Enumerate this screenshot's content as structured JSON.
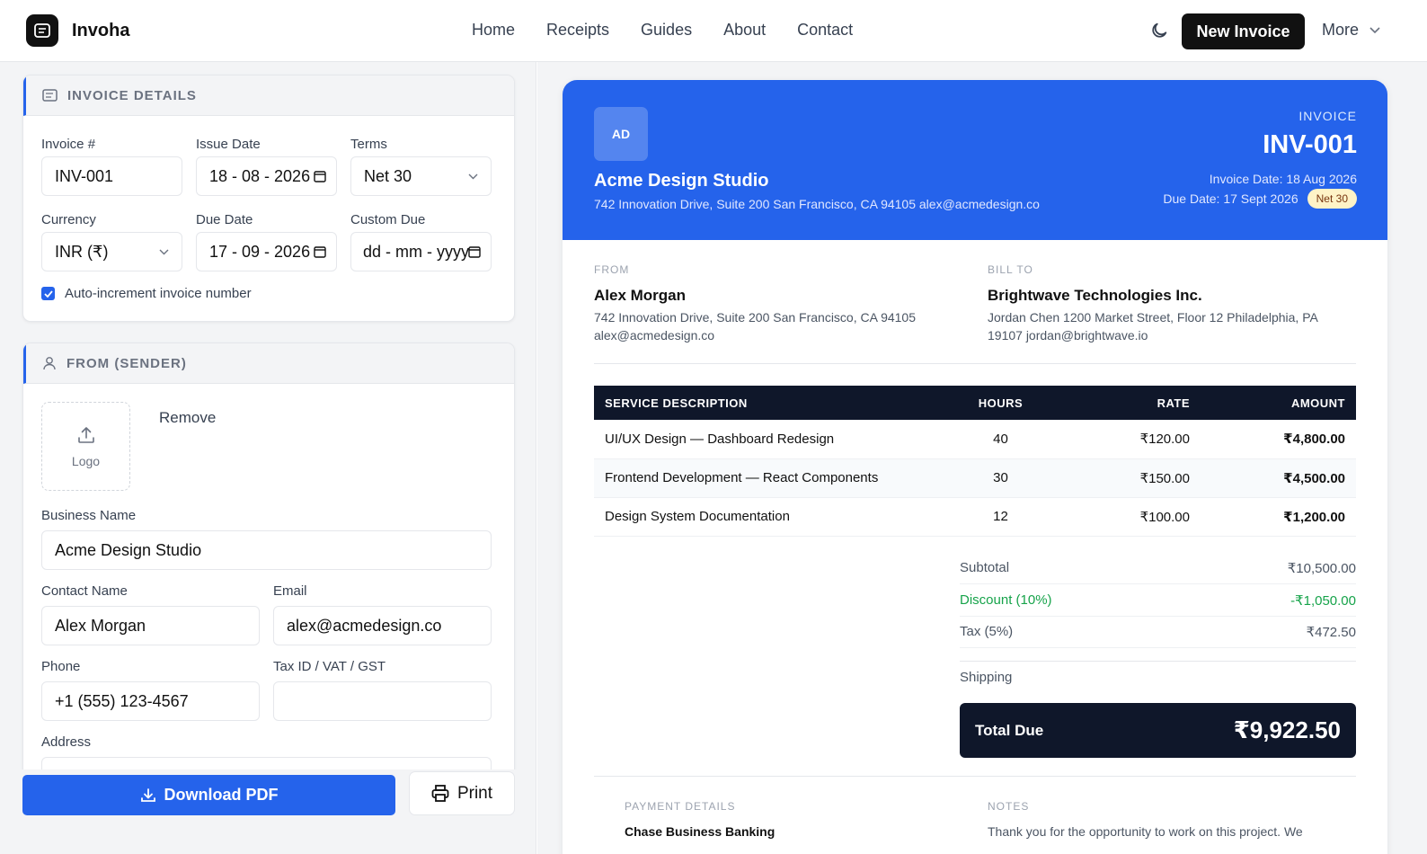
{
  "header": {
    "brand": "Invoha",
    "nav": [
      "Home",
      "Receipts",
      "Guides",
      "About",
      "Contact"
    ],
    "new_invoice": "New Invoice",
    "more": "More"
  },
  "invoice_details": {
    "title": "INVOICE DETAILS",
    "invoice_no_label": "Invoice #",
    "invoice_no": "INV-001",
    "issue_date_label": "Issue Date",
    "issue_date": "18 - 08 - 2026",
    "terms_label": "Terms",
    "terms": "Net 30",
    "currency_label": "Currency",
    "currency": "INR (₹)",
    "due_date_label": "Due Date",
    "due_date": "17 - 09 - 2026",
    "custom_due_label": "Custom Due",
    "custom_due_placeholder": "dd - mm - yyyy",
    "auto_increment_label": "Auto-increment invoice number",
    "auto_increment_checked": true
  },
  "sender": {
    "title": "FROM (SENDER)",
    "logo_label": "Logo",
    "remove": "Remove",
    "business_name_label": "Business Name",
    "business_name": "Acme Design Studio",
    "contact_name_label": "Contact Name",
    "contact_name": "Alex Morgan",
    "email_label": "Email",
    "email": "alex@acmedesign.co",
    "phone_label": "Phone",
    "phone": "+1 (555) 123-4567",
    "tax_id_label": "Tax ID / VAT / GST",
    "tax_id": "",
    "address_label": "Address"
  },
  "actions": {
    "download": "Download PDF",
    "print": "Print"
  },
  "preview": {
    "avatar": "AD",
    "company": "Acme Design Studio",
    "company_address": "742 Innovation Drive, Suite 200 San Francisco, CA 94105 alex@acmedesign.co",
    "invoice_label": "INVOICE",
    "invoice_number": "INV-001",
    "invoice_date": "Invoice Date: 18 Aug 2026",
    "due_date": "Due Date: 17 Sept 2026",
    "terms_badge": "Net 30",
    "from_label": "FROM",
    "from_name": "Alex Morgan",
    "from_address_1": "742 Innovation Drive, Suite 200 San Francisco, CA 94105",
    "from_address_2": "alex@acmedesign.co",
    "bill_to_label": "BILL TO",
    "bill_to_name": "Brightwave Technologies Inc.",
    "bill_to_address_1": "Jordan Chen 1200 Market Street, Floor 12 Philadelphia, PA",
    "bill_to_address_2": "19107 jordan@brightwave.io",
    "columns": [
      "SERVICE DESCRIPTION",
      "HOURS",
      "RATE",
      "AMOUNT"
    ],
    "items": [
      {
        "description": "UI/UX Design — Dashboard Redesign",
        "hours": "40",
        "rate": "₹120.00",
        "amount": "₹4,800.00"
      },
      {
        "description": "Frontend Development — React Components",
        "hours": "30",
        "rate": "₹150.00",
        "amount": "₹4,500.00"
      },
      {
        "description": "Design System Documentation",
        "hours": "12",
        "rate": "₹100.00",
        "amount": "₹1,200.00"
      }
    ],
    "subtotal_label": "Subtotal",
    "subtotal": "₹10,500.00",
    "discount_label": "Discount (10%)",
    "discount": "-₹1,050.00",
    "tax_label": "Tax (5%)",
    "tax": "₹472.50",
    "shipping_label": "Shipping",
    "shipping": "",
    "total_label": "Total Due",
    "total": "₹9,922.50",
    "payment_label": "PAYMENT DETAILS",
    "payment_bank": "Chase Business Banking",
    "notes_label": "NOTES",
    "notes": "Thank you for the opportunity to work on this project. We"
  },
  "colors": {
    "accent": "#2563eb",
    "dark": "#0f172a",
    "discount": "#16a34a",
    "badge": "#fef3c7"
  }
}
